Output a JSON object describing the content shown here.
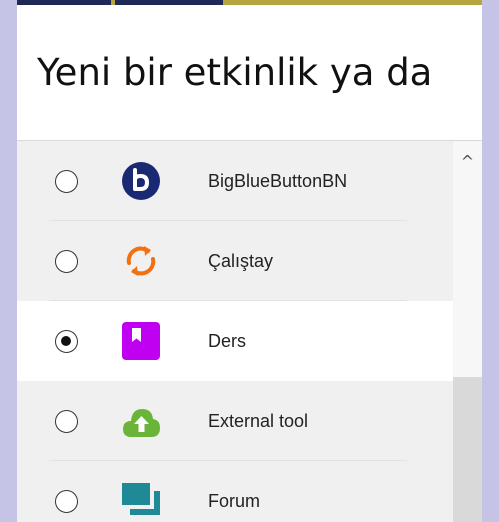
{
  "dialog": {
    "title": "Yeni bir etkinlik ya da"
  },
  "activities": [
    {
      "label": "BigBlueButtonBN",
      "icon": "bigbluebutton-icon",
      "selected": false,
      "color": "#1a2a72"
    },
    {
      "label": "Çalıştay",
      "icon": "workshop-icon",
      "selected": false,
      "color": "#f27012"
    },
    {
      "label": "Ders",
      "icon": "lesson-icon",
      "selected": true,
      "color": "#c000f0"
    },
    {
      "label": "External tool",
      "icon": "external-tool-icon",
      "selected": false,
      "color": "#6ab43a"
    },
    {
      "label": "Forum",
      "icon": "forum-icon",
      "selected": false,
      "color": "#1f8a96"
    }
  ],
  "scrollbar": {
    "up_arrow": "^"
  },
  "colors": {
    "page_background": "#c5c3e6",
    "top_accent": "#b7a640",
    "top_nav": "#1e2a55",
    "list_background": "#f0f0f0",
    "selected_background": "#ffffff"
  }
}
